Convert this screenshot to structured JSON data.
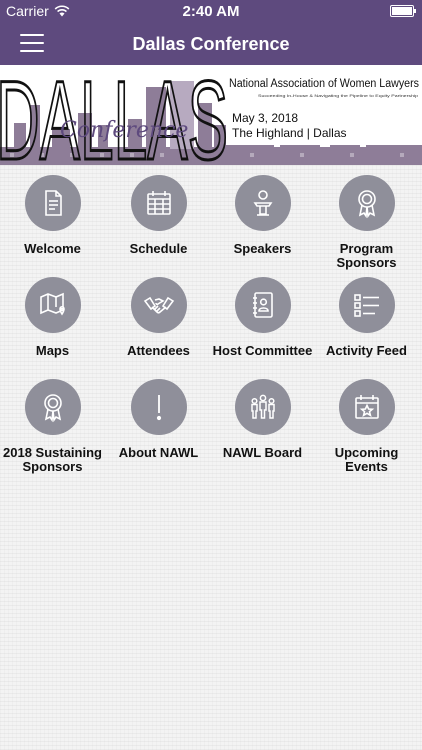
{
  "status_bar": {
    "carrier": "Carrier",
    "time": "2:40 AM"
  },
  "nav": {
    "title": "Dallas Conference",
    "menu_icon": "hamburger-menu-icon"
  },
  "banner": {
    "city": "DALLAS",
    "script_word": "Conference",
    "org": "National Association of Women Lawyers",
    "tagline": "Succeeding In-House & Navigating the Pipeline to Equity Partnership",
    "date": "May 3, 2018",
    "venue": "The Highland | Dallas"
  },
  "tiles": [
    {
      "id": "welcome",
      "label_lines": [
        "Welcome"
      ],
      "icon": "document-icon"
    },
    {
      "id": "schedule",
      "label_lines": [
        "Schedule"
      ],
      "icon": "calendar-icon"
    },
    {
      "id": "speakers",
      "label_lines": [
        "Speakers"
      ],
      "icon": "podium-icon"
    },
    {
      "id": "program-sponsors",
      "label_lines": [
        "Program",
        "Sponsors"
      ],
      "icon": "award-ribbon-icon"
    },
    {
      "id": "maps",
      "label_lines": [
        "Maps"
      ],
      "icon": "map-icon"
    },
    {
      "id": "attendees",
      "label_lines": [
        "Attendees"
      ],
      "icon": "handshake-icon"
    },
    {
      "id": "host-committee",
      "label_lines": [
        "Host Committee"
      ],
      "icon": "address-book-icon"
    },
    {
      "id": "activity-feed",
      "label_lines": [
        "Activity Feed"
      ],
      "icon": "list-icon"
    },
    {
      "id": "sustaining-sponsors",
      "label_lines": [
        "2018 Sustaining",
        "Sponsors"
      ],
      "icon": "award-ribbon-icon"
    },
    {
      "id": "about-nawl",
      "label_lines": [
        "About NAWL"
      ],
      "icon": "exclamation-icon"
    },
    {
      "id": "nawl-board",
      "label_lines": [
        "NAWL Board"
      ],
      "icon": "group-icon"
    },
    {
      "id": "upcoming-events",
      "label_lines": [
        "Upcoming",
        "Events"
      ],
      "icon": "calendar-star-icon"
    }
  ],
  "colors": {
    "header": "#5e4a7e",
    "icon_circle": "#8f8f9a",
    "banner_purple": "#8e7d98"
  }
}
